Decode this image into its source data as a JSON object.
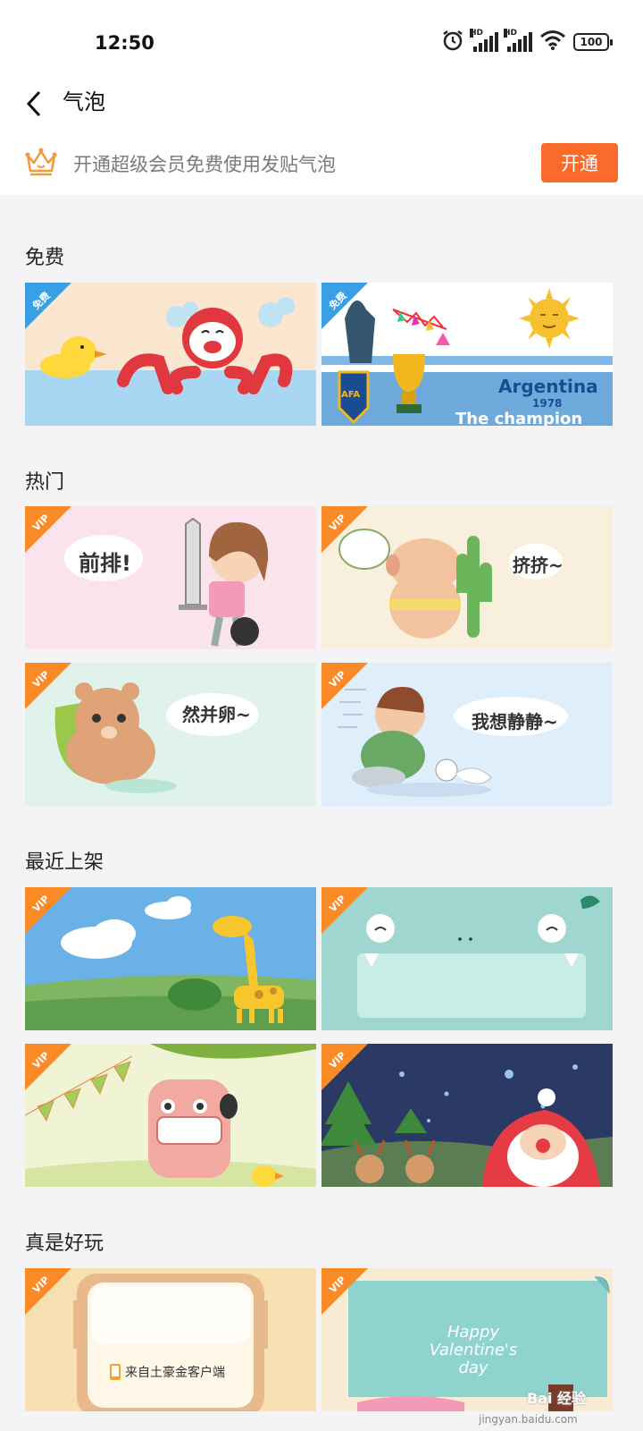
{
  "status": {
    "time": "12:50",
    "battery": "100",
    "hd": "HD"
  },
  "nav": {
    "title": "气泡"
  },
  "vip_bar": {
    "text": "开通超级会员免费使用发贴气泡",
    "button": "开通"
  },
  "sections": [
    {
      "title": "免费"
    },
    {
      "title": "热门"
    },
    {
      "title": "最近上架"
    },
    {
      "title": "真是好玩"
    }
  ],
  "badges": {
    "free": "免费",
    "vip": "VIP"
  },
  "cards": {
    "argentina": {
      "line1": "Argentina",
      "line2": "1978",
      "line3": "The champion",
      "logo": "AFA"
    },
    "front_row": "前排!",
    "squeeze": "挤挤~",
    "ran_bing_luan": "然并卵~",
    "want_quiet": "我想静静~",
    "tuhao": "来自土豪金客户端",
    "valentine": "Happy Valentine's day"
  },
  "watermark": {
    "brand": "Bai 经验",
    "url": "jingyan.baidu.com"
  },
  "colors": {
    "accent": "#fa6a2a",
    "vip_ribbon": "#fa8a26",
    "free_ribbon": "#3aa0e6"
  }
}
